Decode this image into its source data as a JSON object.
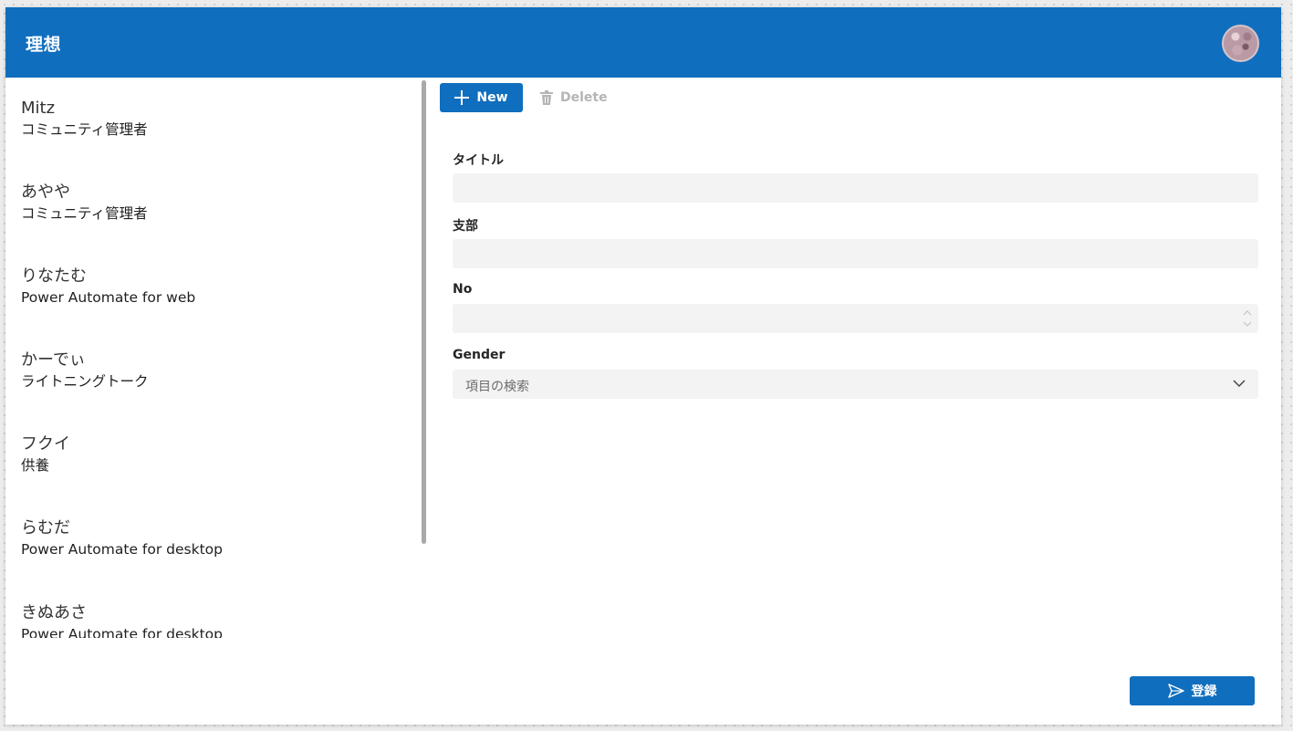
{
  "header": {
    "title": "理想",
    "avatar_icon": "user-avatar"
  },
  "gallery": {
    "items": [
      {
        "name": "Mitz",
        "sub": "コミュニティ管理者"
      },
      {
        "name": "あやや",
        "sub": "コミュニティ管理者"
      },
      {
        "name": "りなたむ",
        "sub": "Power Automate for web"
      },
      {
        "name": "かーでぃ",
        "sub": "ライトニングトーク"
      },
      {
        "name": "フクイ",
        "sub": "供養"
      },
      {
        "name": "らむだ",
        "sub": "Power Automate for desktop"
      },
      {
        "name": "きぬあさ",
        "sub": "Power Automate for desktop"
      }
    ]
  },
  "toolbar": {
    "new_label": "New",
    "new_icon": "plus-icon",
    "delete_label": "Delete",
    "delete_icon": "trash-icon"
  },
  "form": {
    "title_label": "タイトル",
    "title_value": "",
    "branch_label": "支部",
    "branch_value": "",
    "no_label": "No",
    "no_value": "",
    "gender_label": "Gender",
    "gender_placeholder": "項目の検索"
  },
  "submit": {
    "label": "登録",
    "icon": "send-icon"
  },
  "colors": {
    "brand": "#106ebe",
    "input_bg": "#f3f3f3",
    "disabled_text": "#b5b5b5"
  }
}
